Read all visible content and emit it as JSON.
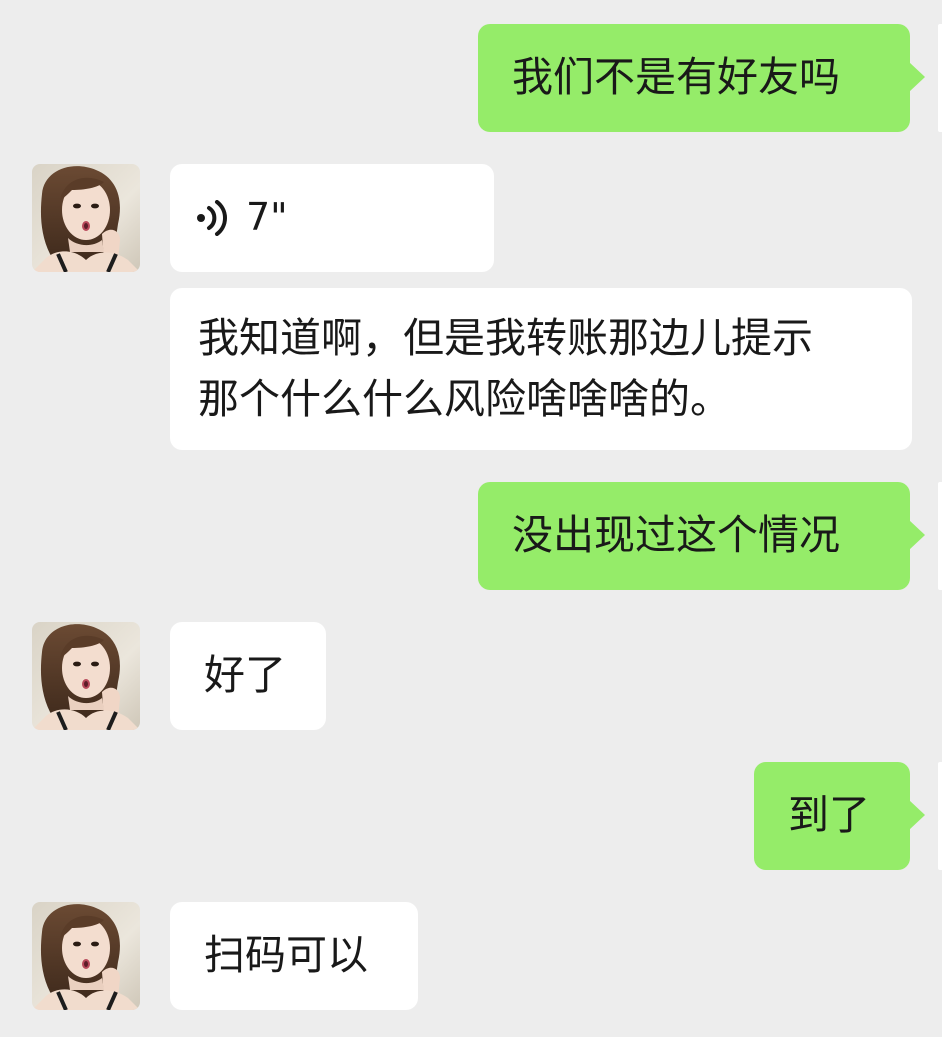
{
  "chat": {
    "colors": {
      "background": "#ededed",
      "incoming_bubble": "#ffffff",
      "outgoing_bubble": "#95ec69",
      "text": "#191919"
    },
    "contact_avatar_icon": "female-contact-avatar",
    "messages": [
      {
        "sender": "me",
        "type": "text",
        "text": "我们不是有好友吗"
      },
      {
        "sender": "contact",
        "type": "voice",
        "icon": "voice-wave-icon",
        "duration": "7\""
      },
      {
        "sender": "contact",
        "type": "text",
        "lines": [
          "我知道啊，但是我转账那边儿提示",
          "那个什么什么风险啥啥啥的。"
        ]
      },
      {
        "sender": "me",
        "type": "text",
        "text": "没出现过这个情况"
      },
      {
        "sender": "contact",
        "type": "text",
        "text": "好了"
      },
      {
        "sender": "me",
        "type": "text",
        "text": "到了"
      },
      {
        "sender": "contact",
        "type": "text",
        "text": "扫码可以"
      }
    ]
  }
}
